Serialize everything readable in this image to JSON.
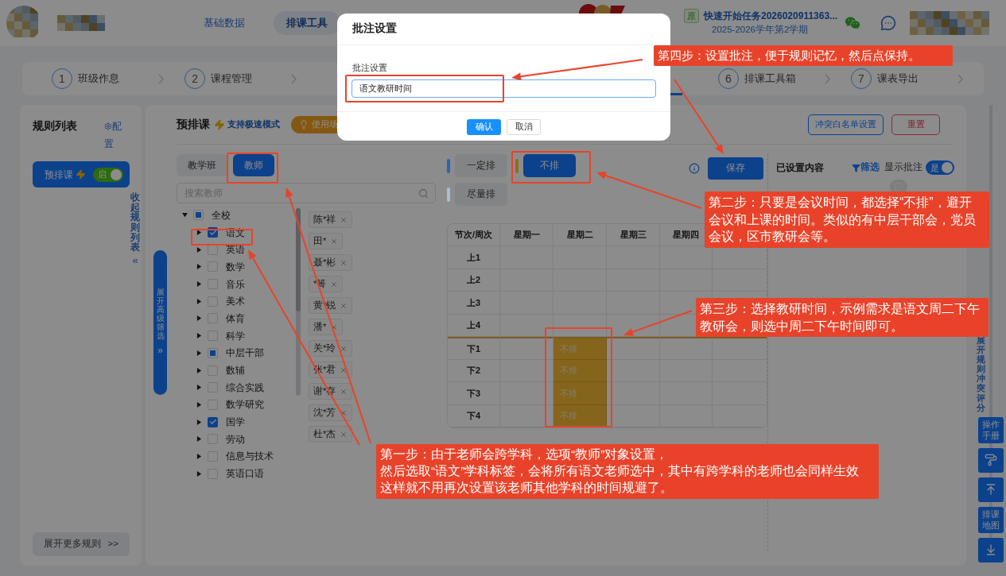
{
  "header": {
    "nav": [
      {
        "label": "基础数据",
        "selected": false
      },
      {
        "label": "排课工具",
        "selected": true
      }
    ],
    "task": {
      "badge": "原",
      "title": "快速开始任务2026020911363...",
      "term": "2025-2026学年第2学期"
    }
  },
  "steps": [
    {
      "number": "1",
      "label": "班级作息",
      "selected": false
    },
    {
      "number": "2",
      "label": "课程管理",
      "selected": false
    },
    {
      "selected": true
    },
    {
      "number": "6",
      "label": "排课工具箱",
      "selected": false
    },
    {
      "number": "7",
      "label": "课表导出",
      "selected": false
    }
  ],
  "rules_panel": {
    "title": "规则列表",
    "config": "配置",
    "rules": [
      {
        "name": "预排课",
        "toggle_label": "启",
        "on": true
      }
    ],
    "collapse": "收起规则列表",
    "collapse_mark": "«",
    "more": "展开更多规则",
    "more_mark": ">>"
  },
  "main": {
    "title": "预排课",
    "speed": "支持极速模式",
    "scene_button": "使用场",
    "whitelist_button": "冲突白名单设置",
    "reset_button": "重置",
    "filter_expand": "展开高级筛选",
    "filter_expand_mark": "»"
  },
  "object_tabs": [
    {
      "label": "教学班",
      "selected": false
    },
    {
      "label": "教师",
      "selected": true
    }
  ],
  "search": {
    "placeholder": "搜索教师"
  },
  "tree": [
    {
      "label": "全校",
      "expanded": true,
      "checked": false,
      "partial": true,
      "children": [
        {
          "label": "语文",
          "expanded": false,
          "checked": true
        },
        {
          "label": "英语",
          "expanded": false,
          "checked": false,
          "partial": false
        },
        {
          "label": "数学",
          "expanded": false,
          "checked": false,
          "partial": false
        },
        {
          "label": "音乐",
          "expanded": false,
          "checked": false,
          "partial": false
        },
        {
          "label": "美术",
          "expanded": false,
          "checked": false,
          "partial": false
        },
        {
          "label": "体育",
          "expanded": false,
          "checked": false,
          "partial": false
        },
        {
          "label": "科学",
          "expanded": false,
          "checked": false,
          "partial": false
        },
        {
          "label": "中层干部",
          "expanded": false,
          "checked": false,
          "partial": true
        },
        {
          "label": "数辅",
          "expanded": false,
          "checked": false,
          "partial": false
        },
        {
          "label": "综合实践",
          "expanded": false,
          "checked": false,
          "partial": false
        },
        {
          "label": "数学研究",
          "expanded": false,
          "checked": false,
          "partial": false
        },
        {
          "label": "国学",
          "expanded": false,
          "checked": true
        },
        {
          "label": "劳动",
          "expanded": false,
          "checked": false,
          "partial": false
        },
        {
          "label": "信息与技术",
          "expanded": false,
          "checked": false,
          "partial": false
        },
        {
          "label": "英语口语",
          "expanded": false,
          "checked": false,
          "partial": false
        }
      ]
    }
  ],
  "teachers": [
    "陈*祥",
    "田*",
    "聂*彬",
    "*箐",
    "黄*锐",
    "潘*",
    "关*玲",
    "张*君",
    "谢*存",
    "沈*芳",
    "杜*杰"
  ],
  "modes": [
    {
      "label": "一定排",
      "selected": false,
      "color": "#2a66b0"
    },
    {
      "label": "不排",
      "selected": true,
      "color": "#8f6d1f"
    },
    {
      "label": "尽量排",
      "selected": false,
      "color": "#a7bed6"
    }
  ],
  "save_button": "保存",
  "timetable": {
    "columns": [
      "节次/周次",
      "星期一",
      "星期二",
      "星期三",
      "星期四"
    ],
    "rows": [
      {
        "label": "上1",
        "afternoon_start": false,
        "cells": [
          {
            "kind": "empty"
          },
          {
            "kind": "empty"
          },
          {
            "kind": "empty"
          },
          {
            "kind": "empty"
          }
        ]
      },
      {
        "label": "上2",
        "afternoon_start": false,
        "cells": [
          {
            "kind": "empty"
          },
          {
            "kind": "empty"
          },
          {
            "kind": "empty"
          },
          {
            "kind": "empty"
          }
        ]
      },
      {
        "label": "上3",
        "afternoon_start": false,
        "cells": [
          {
            "kind": "empty"
          },
          {
            "kind": "empty"
          },
          {
            "kind": "empty"
          },
          {
            "kind": "empty"
          }
        ]
      },
      {
        "label": "上4",
        "afternoon_start": false,
        "cells": [
          {
            "kind": "empty"
          },
          {
            "kind": "empty"
          },
          {
            "kind": "empty"
          },
          {
            "kind": "empty"
          }
        ]
      },
      {
        "label": "下1",
        "afternoon_start": true,
        "cells": [
          {
            "kind": "empty"
          },
          {
            "kind": "blocked",
            "text": "不排"
          },
          {
            "kind": "empty"
          },
          {
            "kind": "empty"
          }
        ]
      },
      {
        "label": "下2",
        "afternoon_start": false,
        "cells": [
          {
            "kind": "empty"
          },
          {
            "kind": "blocked",
            "text": "不排"
          },
          {
            "kind": "empty"
          },
          {
            "kind": "empty"
          }
        ]
      },
      {
        "label": "下3",
        "afternoon_start": false,
        "cells": [
          {
            "kind": "empty"
          },
          {
            "kind": "blocked",
            "text": "不排"
          },
          {
            "kind": "empty"
          },
          {
            "kind": "empty"
          }
        ]
      },
      {
        "label": "下4",
        "afternoon_start": false,
        "cells": [
          {
            "kind": "empty"
          },
          {
            "kind": "blocked",
            "text": "不排"
          },
          {
            "kind": "empty"
          },
          {
            "kind": "empty"
          }
        ]
      }
    ]
  },
  "settings_panel": {
    "title": "已设置内容",
    "filter": "筛选",
    "show_notes_label": "显示批注",
    "show_notes": {
      "label": "是",
      "on": true
    }
  },
  "side_tools": {
    "vertical_text": "展开规则冲突评分",
    "buttons": [
      {
        "kind": "text",
        "label": "操作手册"
      },
      {
        "kind": "roller"
      },
      {
        "kind": "top"
      },
      {
        "kind": "text",
        "label": "排课地图"
      },
      {
        "kind": "download"
      }
    ]
  },
  "modal": {
    "title": "批注设置",
    "field_label": "批注设置",
    "value": "语文教研时间",
    "confirm": "确认",
    "cancel": "取消"
  },
  "callouts": [
    {
      "lines": [
        "第四步：设置批注，便于规则记忆，然后点保持。"
      ]
    },
    {
      "lines": [
        "第二步：只要是会议时间，都选择“不排”，避开",
        "会议和上课的时间。类似的有中层干部会，党员",
        "会议，区市教研会等。"
      ]
    },
    {
      "lines": [
        "第三步：选择教研时间，示例需求是语文周二下午",
        "教研会，则选中周二下午时间即可。"
      ]
    },
    {
      "lines": [
        "第一步：由于老师会跨学科，选项“教师”对象设置，",
        "然后选取“语文”学科标签，会将所有语文老师选中，其中有跨学科的老师也会同样生效",
        "这样就不用再次设置该老师其他学科的时间规避了。"
      ]
    }
  ]
}
